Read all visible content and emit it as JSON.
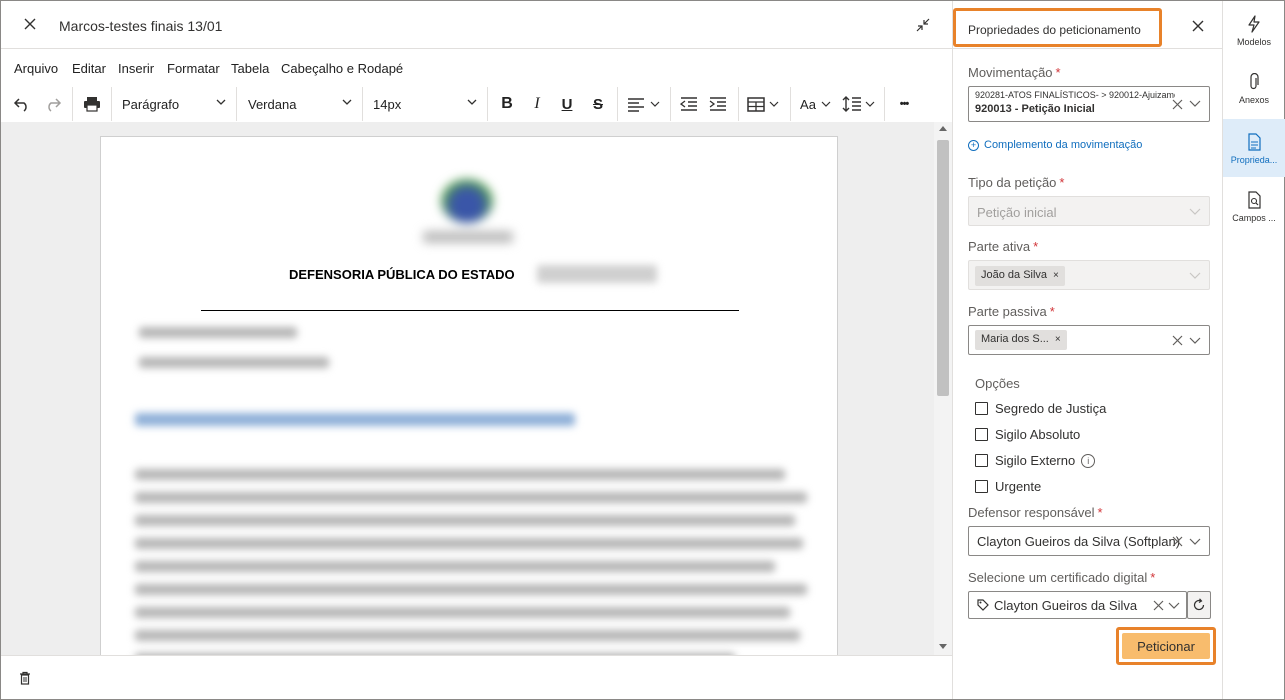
{
  "editor": {
    "doc_title": "Marcos-testes finais 13/01",
    "menu": [
      "Arquivo",
      "Editar",
      "Inserir",
      "Formatar",
      "Tabela",
      "Cabeçalho e Rodapé"
    ],
    "toolbar": {
      "paragraph_style": "Parágrafo",
      "font_family": "Verdana",
      "font_size": "14px",
      "bold_glyph": "B",
      "italic_glyph": "I",
      "underline_glyph": "U",
      "strike_glyph": "S",
      "text_case_glyph": "Aa",
      "more_glyph": "•••"
    },
    "document": {
      "org_title": "DEFENSORIA PÚBLICA DO ESTADO"
    }
  },
  "panel": {
    "title": "Propriedades do peticionamento",
    "movimentacao": {
      "label": "Movimentação",
      "line1": "920281-ATOS FINALÍSTICOS- > 920012-Ajuizamento",
      "line2": "920013 - Petição Inicial"
    },
    "complemento_link": "Complemento da movimentação",
    "tipo_peticao": {
      "label": "Tipo da petição",
      "value": "Petição inicial"
    },
    "parte_ativa": {
      "label": "Parte ativa",
      "tag": "João da Silva"
    },
    "parte_passiva": {
      "label": "Parte passiva",
      "tag": "Maria dos S..."
    },
    "opcoes": {
      "title": "Opções",
      "items": [
        "Segredo de Justiça",
        "Sigilo Absoluto",
        "Sigilo Externo",
        "Urgente"
      ]
    },
    "defensor": {
      "label": "Defensor responsável",
      "value": "Clayton Gueiros da Silva (Softplan)"
    },
    "certificado": {
      "label": "Selecione um certificado digital",
      "value": "Clayton Gueiros da Silva"
    },
    "submit_label": "Peticionar",
    "required_mark": "*",
    "info_glyph": "i",
    "tag_remove_glyph": "×"
  },
  "rail": {
    "items": [
      "Modelos",
      "Anexos",
      "Proprieda...",
      "Campos ..."
    ],
    "active_index": 2
  },
  "colors": {
    "highlight": "#e8822a",
    "submit_bg": "#f8bc6d",
    "link": "#106ebe",
    "required": "#d13438"
  }
}
